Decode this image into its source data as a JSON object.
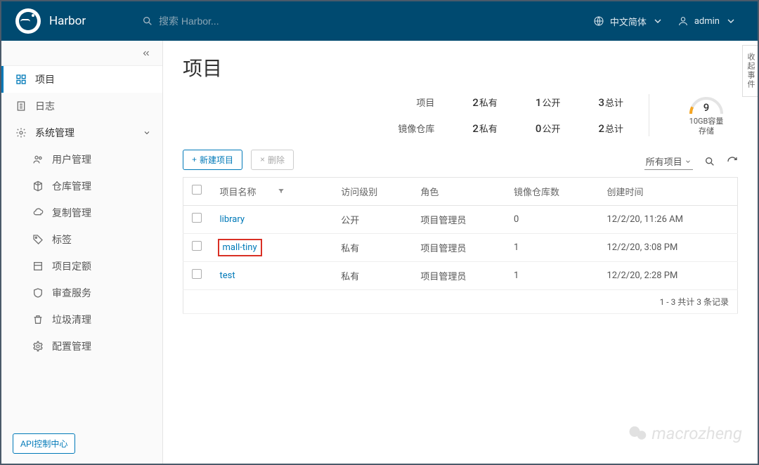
{
  "header": {
    "brand": "Harbor",
    "search_placeholder": "搜索 Harbor...",
    "language_label": "中文简体",
    "user_label": "admin"
  },
  "sidebar": {
    "items": {
      "projects": "项目",
      "logs": "日志",
      "admin": "系统管理",
      "users": "用户管理",
      "registries": "仓库管理",
      "replication": "复制管理",
      "labels": "标签",
      "quotas": "项目定额",
      "interrogation": "审查服务",
      "gc": "垃圾清理",
      "config": "配置管理"
    },
    "api_button": "API控制中心"
  },
  "page": {
    "title": "项目",
    "stats": {
      "row1_label": "项目",
      "row2_label": "镜像仓库",
      "private_suffix": "私有",
      "public_suffix": "公开",
      "total_suffix": "总计",
      "proj_private": "2",
      "proj_public": "1",
      "proj_total": "3",
      "repo_private": "2",
      "repo_public": "0",
      "repo_total": "2",
      "gauge_value": "9",
      "gauge_line1": "10GB容量",
      "gauge_line2": "存储"
    },
    "toolbar": {
      "new_project": "新建项目",
      "delete": "删除",
      "filter_select": "所有项目"
    },
    "table": {
      "columns": {
        "name": "项目名称",
        "access": "访问级别",
        "role": "角色",
        "repo_count": "镜像仓库数",
        "created": "创建时间"
      },
      "rows": [
        {
          "name": "library",
          "access": "公开",
          "role": "项目管理员",
          "repo_count": "0",
          "created": "12/2/20, 11:26 AM"
        },
        {
          "name": "mall-tiny",
          "access": "私有",
          "role": "项目管理员",
          "repo_count": "1",
          "created": "12/2/20, 3:08 PM"
        },
        {
          "name": "test",
          "access": "私有",
          "role": "项目管理员",
          "repo_count": "1",
          "created": "12/2/20, 2:28 PM"
        }
      ],
      "footer": "1 - 3 共计 3 条记录"
    }
  },
  "side_tab": "收起事件",
  "watermark": "macrozheng",
  "colors": {
    "primary": "#004a70",
    "link": "#0079b8",
    "highlight": "#d93025",
    "gauge": "#f5a623"
  }
}
